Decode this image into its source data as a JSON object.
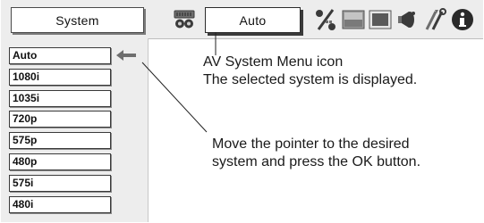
{
  "menu": {
    "title": "System",
    "selected_value": "Auto",
    "icons": [
      "av-system-menu-icon",
      "percent-icon",
      "image-icon",
      "screen-icon",
      "sound-icon",
      "tools-icon",
      "info-icon"
    ]
  },
  "system_list": {
    "items": [
      "Auto",
      "1080i",
      "1035i",
      "720p",
      "575p",
      "480p",
      "575i",
      "480i"
    ],
    "selected_index": 0
  },
  "callouts": {
    "icon_line1": "AV System Menu icon",
    "icon_line2": "The selected system is displayed.",
    "pointer_line1": "Move the pointer to the desired",
    "pointer_line2": "system and press the OK button."
  },
  "colors": {
    "panel_bg": "#ededed",
    "border": "#3a3a3a",
    "icon_dark": "#3b3b3b",
    "icon_mid": "#6e6e6e"
  }
}
